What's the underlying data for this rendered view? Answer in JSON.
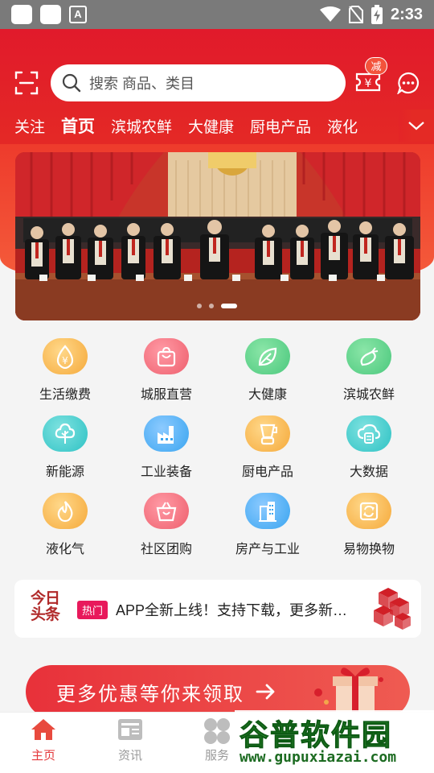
{
  "status_bar": {
    "time": "2:33",
    "app_glyph": "A"
  },
  "header": {
    "search_placeholder": "搜索 商品、类目",
    "coupon_badge": "减",
    "tabs": [
      "关注",
      "首页",
      "滨城农鲜",
      "大健康",
      "厨电产品",
      "液化"
    ],
    "active_tab": "首页"
  },
  "banner": {
    "slides": 3,
    "active_index": 2
  },
  "grid": [
    {
      "label": "生活缴费",
      "icon": "money-drop-icon",
      "color": "#f5a93a"
    },
    {
      "label": "城服直营",
      "icon": "shopping-bag-icon",
      "color": "#ee5f6d"
    },
    {
      "label": "大健康",
      "icon": "leaf-icon",
      "color": "#4bc87d"
    },
    {
      "label": "滨城农鲜",
      "icon": "vegetable-icon",
      "color": "#4bc87d"
    },
    {
      "label": "新能源",
      "icon": "tree-icon",
      "color": "#2ec2c4"
    },
    {
      "label": "工业装备",
      "icon": "factory-icon",
      "color": "#3aa5f0"
    },
    {
      "label": "厨电产品",
      "icon": "blender-icon",
      "color": "#f5a93a"
    },
    {
      "label": "大数据",
      "icon": "cloud-data-icon",
      "color": "#2ec2c4"
    },
    {
      "label": "液化气",
      "icon": "flame-icon",
      "color": "#f5a93a"
    },
    {
      "label": "社区团购",
      "icon": "basket-icon",
      "color": "#ee5f6d"
    },
    {
      "label": "房产与工业",
      "icon": "building-icon",
      "color": "#3aa5f0"
    },
    {
      "label": "易物换物",
      "icon": "exchange-icon",
      "color": "#f5a93a"
    }
  ],
  "news": {
    "logo_line1": "今日",
    "logo_line2": "头条",
    "tag": "热门",
    "text": "APP全新上线！支持下载，更多新功能"
  },
  "promo": {
    "text": "更多优惠等你来领取"
  },
  "bottom_nav": [
    {
      "label": "主页",
      "icon": "home-icon",
      "active": true
    },
    {
      "label": "资讯",
      "icon": "news-icon",
      "active": false
    },
    {
      "label": "服务",
      "icon": "services-icon",
      "active": false
    }
  ],
  "watermark": {
    "title": "谷普软件园",
    "url": "www.gupuxiazai.com"
  },
  "colors": {
    "brand_red": "#e11a2b",
    "active_nav": "#e4393c"
  }
}
